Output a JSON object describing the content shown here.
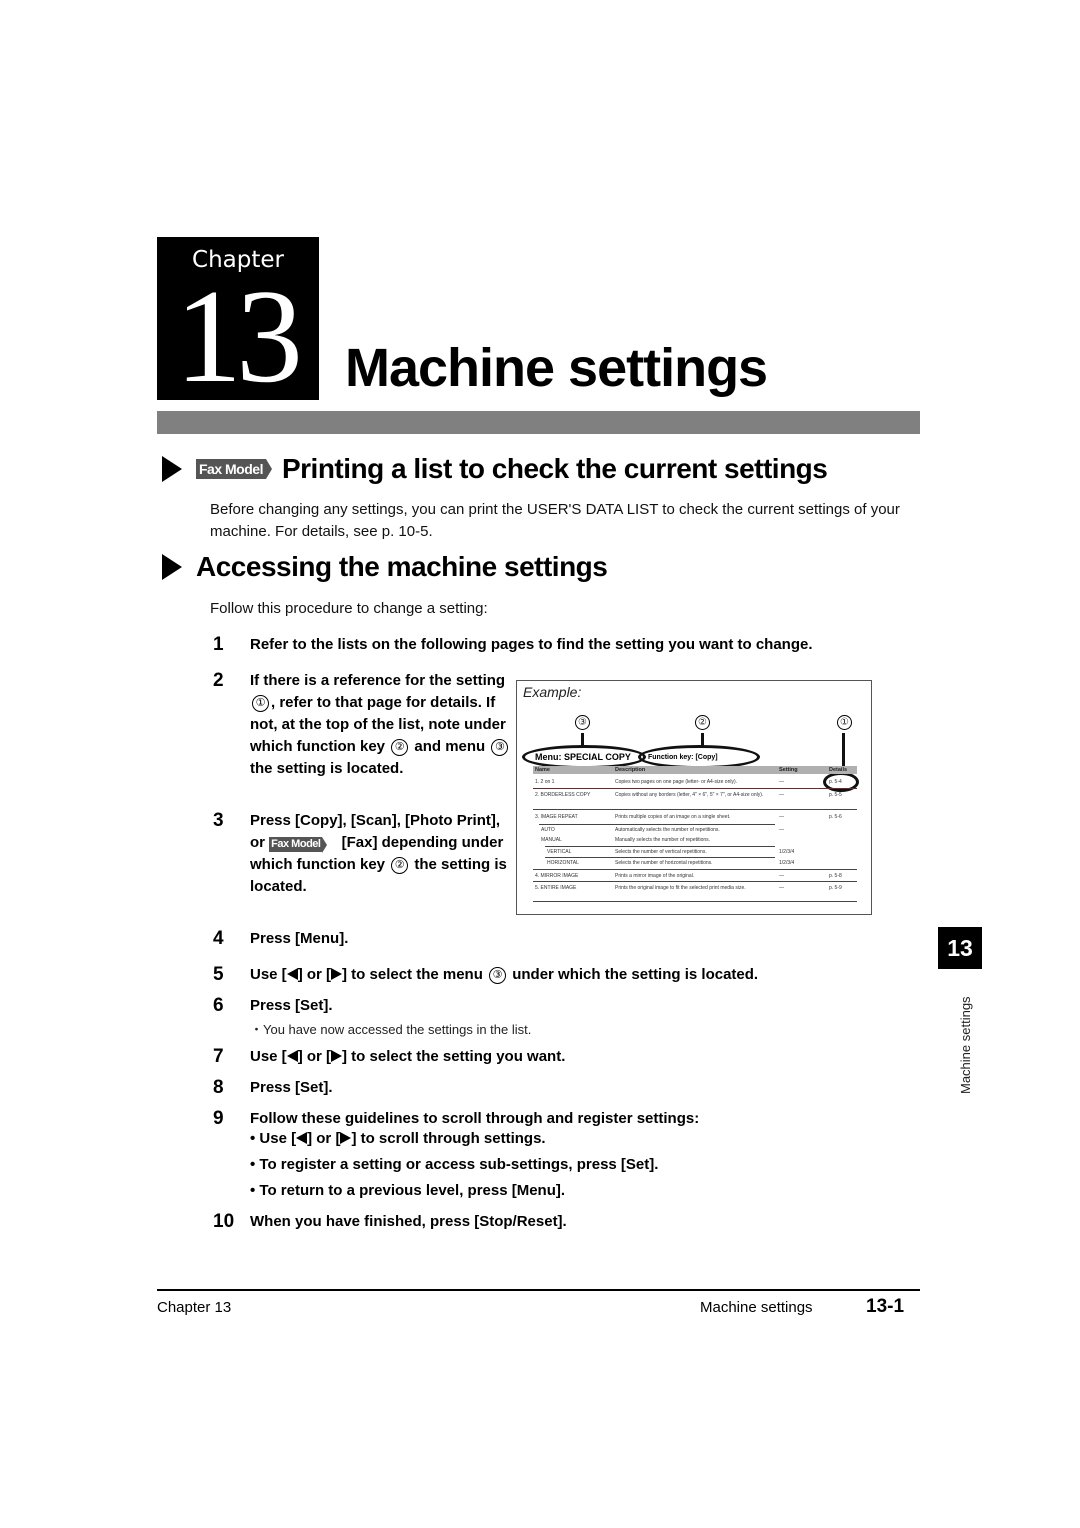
{
  "chapter": {
    "word": "Chapter",
    "number": "13",
    "title": "Machine settings"
  },
  "sections": [
    {
      "title": "Printing a list to check the current settings",
      "badge": "Fax Model",
      "body": "Before changing any settings, you can print the USER'S DATA LIST to check the current settings of your machine. For details, see p. 10-5."
    },
    {
      "title": "Accessing the machine settings",
      "intro": "Follow this procedure to change a setting:"
    }
  ],
  "steps": [
    {
      "num": "1",
      "text": "Refer to the lists on the following pages to find the setting you want to change."
    },
    {
      "num": "2",
      "parts": [
        "If there is a reference for the setting ",
        "①",
        ", refer to that page for details. If not, at the top of the list, note under which function key ",
        "②",
        " and menu ",
        "③",
        " the setting is located."
      ]
    },
    {
      "num": "3",
      "parts": [
        "Press [Copy], [Scan], [Photo Print], or ",
        "Fax Model",
        " [Fax] depending under which function key ",
        "②",
        " the setting is located."
      ]
    },
    {
      "num": "4",
      "text": "Press [Menu]."
    },
    {
      "num": "5",
      "parts": [
        "Use [",
        "] or [",
        "] to select the menu ",
        "③",
        " under which the setting is located."
      ]
    },
    {
      "num": "6",
      "text": "Press [Set].",
      "note": "・You have now accessed the settings in the list."
    },
    {
      "num": "7",
      "parts": [
        "Use [",
        "] or [",
        "] to select the setting you want."
      ]
    },
    {
      "num": "8",
      "text": "Press [Set]."
    },
    {
      "num": "9",
      "text": "Follow these guidelines to scroll through and register settings:",
      "bullets": [
        {
          "parts": [
            "Use [",
            "] or [",
            "] to scroll through settings."
          ]
        },
        {
          "text": "To register a setting or access sub-settings, press [Set]."
        },
        {
          "text": "To return to a previous level, press [Menu]."
        }
      ]
    },
    {
      "num": "10",
      "text": "When you have finished, press [Stop/Reset]."
    }
  ],
  "example": {
    "label": "Example:",
    "callouts": [
      "③",
      "②",
      "①"
    ],
    "menu": "Menu: SPECIAL COPY",
    "function_key": "Function key: [Copy]",
    "columns": [
      "Name",
      "Description",
      "Setting",
      "Details"
    ],
    "rows": [
      {
        "name": "1. 2 on 1",
        "desc": "Copies two pages on one page (letter- or A4-size only).",
        "setting": "—",
        "details": "p. 5-4"
      },
      {
        "name": "2. BORDERLESS COPY",
        "desc": "Copies without any borders (letter, 4\" × 6\", 5\" × 7\", or A4-size only).",
        "setting": "—",
        "details": "p. 5-5"
      },
      {
        "name": "3. IMAGE REPEAT",
        "desc": "Prints multiple copies of an image on a single sheet.",
        "setting": "—",
        "details": "p. 5-6"
      },
      {
        "name": "AUTO",
        "desc": "Automatically selects the number of repetitions.",
        "setting": "—",
        "details": ""
      },
      {
        "name": "MANUAL",
        "desc": "Manually selects the number of repetitions.",
        "setting": "",
        "details": ""
      },
      {
        "name": "VERTICAL",
        "desc": "Selects the number of vertical repetitions.",
        "setting": "1/2/3/4",
        "details": ""
      },
      {
        "name": "HORIZONTAL",
        "desc": "Selects the number of horizontal repetitions.",
        "setting": "1/2/3/4",
        "details": ""
      },
      {
        "name": "4. MIRROR IMAGE",
        "desc": "Prints a mirror image of the original.",
        "setting": "—",
        "details": "p. 5-8"
      },
      {
        "name": "5. ENTIRE IMAGE",
        "desc": "Prints the original image to fit the selected print media size.",
        "setting": "—",
        "details": "p. 5-9"
      }
    ]
  },
  "side_tab": {
    "number": "13",
    "label": "Machine settings"
  },
  "footer": {
    "left": "Chapter 13",
    "middle": "Machine settings",
    "page": "13-1"
  }
}
